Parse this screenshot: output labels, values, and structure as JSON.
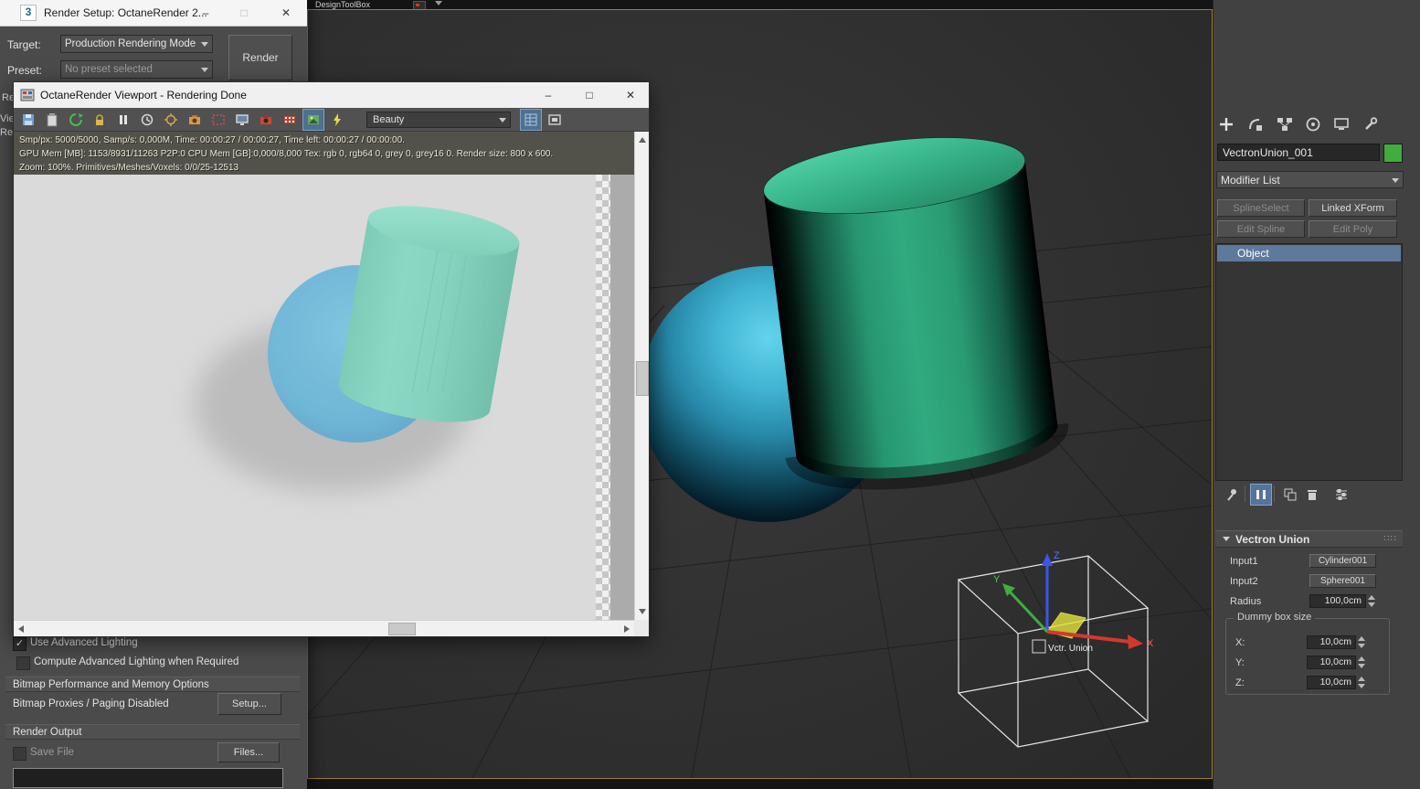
{
  "colors": {
    "viewport_border": "#9a7f2a",
    "stack_selection": "#5d7a9c",
    "object_color_swatch": "#3fae3c",
    "toolbar_selected": "#56749a",
    "render_background": "#dadada"
  },
  "window_controls": {
    "minimize": "–",
    "maximize": "□",
    "close": "✕"
  },
  "top_bar": {
    "title": "DesignToolBox"
  },
  "render_setup": {
    "title": "Render Setup: OctaneRender 2...",
    "target_label": "Target:",
    "target_value": "Production Rendering Mode",
    "preset_label": "Preset:",
    "preset_value": "No preset selected",
    "render_button": "Render",
    "edge_fragments": {
      "f1": "Re",
      "f2": "Vie",
      "f3": "Re"
    },
    "advanced_lighting": {
      "use": "Use Advanced Lighting",
      "compute": "Compute Advanced Lighting when Required"
    },
    "bitmap_section": {
      "header": "Bitmap Performance and Memory Options",
      "status": "Bitmap Proxies / Paging Disabled",
      "setup_button": "Setup..."
    },
    "render_output": {
      "header": "Render Output",
      "save_file": "Save File",
      "files_button": "Files..."
    }
  },
  "octane_viewport": {
    "title": "OctaneRender Viewport - Rendering Done",
    "render_pass": "Beauty",
    "status": {
      "line1": "Smp/px: 5000/5000,   Samp/s: 0,000M,   Time: 00:00:27 / 00:00:27,   Time left: 00:00:27 / 00:00:00.",
      "line2": "GPU Mem [MB]: 1153/8931/11263 P2P:0   CPU Mem [GB]:0,000/8,000   Tex: rgb 0, rgb64 0, grey 0, grey16 0.   Render size: 800 x 600.",
      "line3": "Zoom: 100%.   Primitives/Meshes/Voxels: 0/0/25-12513"
    }
  },
  "command_panel": {
    "object_name": "VectronUnion_001",
    "modifier_list_label": "Modifier List",
    "modifier_buttons": [
      {
        "label": "SplineSelect",
        "enabled": false
      },
      {
        "label": "Linked XForm",
        "enabled": true
      },
      {
        "label": "Edit Spline",
        "enabled": false
      },
      {
        "label": "Edit Poly",
        "enabled": false
      }
    ],
    "stack_items": [
      "Object"
    ],
    "rollout": {
      "title": "Vectron Union",
      "input1_label": "Input1",
      "input1_value": "Cylinder001",
      "input2_label": "Input2",
      "input2_value": "Sphere001",
      "radius_label": "Radius",
      "radius_value": "100,0cm",
      "group_title": "Dummy box size",
      "x_label": "X:",
      "x_value": "10,0cm",
      "y_label": "Y:",
      "y_value": "10,0cm",
      "z_label": "Z:",
      "z_value": "10,0cm"
    }
  },
  "viewport": {
    "gizmo_label": "Vctr. Union",
    "axis_x": "X",
    "axis_y": "Y",
    "axis_z": "Z"
  }
}
